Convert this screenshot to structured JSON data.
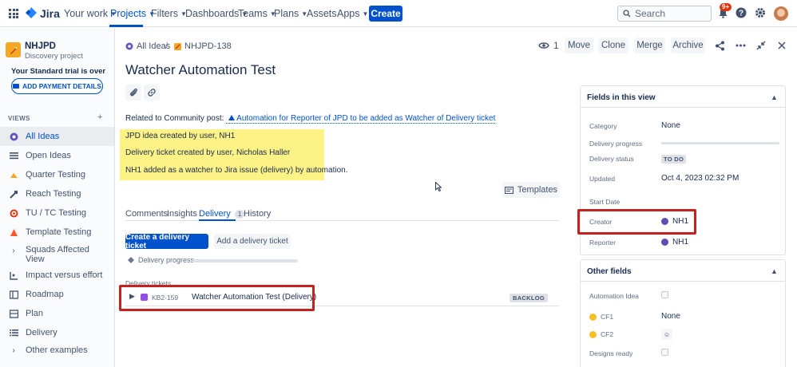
{
  "topnav": {
    "logo": "Jira",
    "items": [
      {
        "label": "Your work"
      },
      {
        "label": "Projects"
      },
      {
        "label": "Filters"
      },
      {
        "label": "Dashboards"
      },
      {
        "label": "Teams"
      },
      {
        "label": "Plans"
      },
      {
        "label": "Assets"
      },
      {
        "label": "Apps"
      }
    ],
    "create_label": "Create",
    "search_placeholder": "Search",
    "notifications_badge": "9+"
  },
  "sidebar": {
    "project_name": "NHJPD",
    "project_type": "Discovery project",
    "trial_text": "Your Standard trial is over",
    "payment_button": "ADD PAYMENT DETAILS",
    "views_heading": "VIEWS",
    "items": [
      {
        "label": "All Ideas",
        "icon": "idea-icon"
      },
      {
        "label": "Open Ideas",
        "icon": "list-icon"
      },
      {
        "label": "Quarter Testing",
        "icon": "bar-icon"
      },
      {
        "label": "Reach Testing",
        "icon": "board-icon"
      },
      {
        "label": "TU / TC Testing",
        "icon": "target-icon"
      },
      {
        "label": "Template Testing",
        "icon": "timeline-icon"
      },
      {
        "label": "Squads Affected View",
        "icon": "chevron-right-icon"
      },
      {
        "label": "Impact versus effort",
        "icon": "matrix-icon"
      },
      {
        "label": "Roadmap",
        "icon": "roadmap-icon"
      },
      {
        "label": "Plan",
        "icon": "plan-icon"
      },
      {
        "label": "Delivery",
        "icon": "list-icon"
      },
      {
        "label": "Other examples",
        "icon": "chevron-right-icon"
      }
    ]
  },
  "header": {
    "breadcrumb_all": "All Ideas",
    "breadcrumb_key": "NHJPD-138",
    "watch_count": "1",
    "actions": [
      "Move",
      "Clone",
      "Merge",
      "Archive"
    ]
  },
  "issue": {
    "title": "Watcher Automation Test",
    "related_prefix": "Related to Community post:",
    "related_link": "Automation for Reporter of JPD to be added as Watcher of Delivery ticket",
    "highlight_lines": [
      "JPD idea created by user, NH1",
      "Delivery ticket created by user, Nicholas Haller",
      "NH1 added as a watcher to Jira issue (delivery) by automation."
    ],
    "templates_label": "Templates"
  },
  "tabs": [
    {
      "label": "Comments"
    },
    {
      "label": "Insights"
    },
    {
      "label": "Delivery",
      "count": "1"
    },
    {
      "label": "History"
    }
  ],
  "delivery": {
    "create_button": "Create a delivery ticket",
    "add_button": "Add a delivery ticket",
    "progress_label": "Delivery progress",
    "tickets_label": "Delivery tickets",
    "ticket": {
      "key": "KB2-159",
      "title": "Watcher Automation Test (Delivery)",
      "status": "BACKLOG"
    }
  },
  "fields_panel": {
    "heading": "Fields in this view",
    "fields": {
      "category": {
        "label": "Category",
        "value": "None"
      },
      "delivery_progress": {
        "label": "Delivery progress"
      },
      "delivery_status": {
        "label": "Delivery status",
        "value": "TO DO"
      },
      "updated": {
        "label": "Updated",
        "value": "Oct 4, 2023 02:32 PM"
      },
      "start_date": {
        "label": "Start Date"
      },
      "creator": {
        "label": "Creator",
        "value": "NH1"
      },
      "reporter": {
        "label": "Reporter",
        "value": "NH1"
      }
    }
  },
  "other_panel": {
    "heading": "Other fields",
    "fields": {
      "automation_idea": {
        "label": "Automation Idea"
      },
      "cf1": {
        "label": "CF1",
        "value": "None"
      },
      "cf2": {
        "label": "CF2"
      },
      "designs_ready": {
        "label": "Designs ready"
      }
    }
  }
}
